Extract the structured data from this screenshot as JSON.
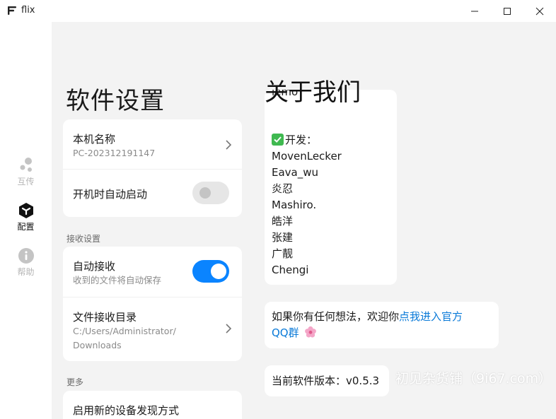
{
  "window": {
    "title": "flix",
    "min_icon": "minimize-icon",
    "max_icon": "maximize-icon",
    "close_icon": "close-icon"
  },
  "nav": {
    "items": [
      {
        "label": "互传",
        "icon": "share-icon",
        "active": false
      },
      {
        "label": "配置",
        "icon": "config-icon",
        "active": true
      },
      {
        "label": "帮助",
        "icon": "info-icon",
        "active": false
      }
    ]
  },
  "settings": {
    "title": "软件设置",
    "device_name_label": "本机名称",
    "device_name_value": "PC-202312191147",
    "autostart_label": "开机时自动启动",
    "autostart_on": false,
    "receive_section": "接收设置",
    "auto_receive_label": "自动接收",
    "auto_receive_desc": "收到的文件将自动保存",
    "auto_receive_on": true,
    "receive_dir_label": "文件接收目录",
    "receive_dir_line1": "C:/Users/Administrator/",
    "receive_dir_line2": "Downloads",
    "more_section": "更多",
    "new_discovery_label": "启用新的设备发现方式"
  },
  "about": {
    "title": "关于我们",
    "credits_partial": "lemo",
    "dev_heading": "开发：",
    "developers": [
      "MovenLecker",
      "Eava_wu",
      "炎忍",
      "Mashiro.",
      "皓洋",
      "张建",
      "广靓",
      "Chengi"
    ],
    "feedback_text": "如果你有任何想法，欢迎你",
    "feedback_link_1": "点我进入官方",
    "feedback_link_2": "QQ群",
    "version_text": "当前软件版本：v0.5.3"
  },
  "watermark": "初见杂货铺（9i67.com）",
  "colors": {
    "accent": "#0a84ff",
    "link": "#0a7ad8",
    "panel_bg": "#f3f3f3",
    "check": "#3fb950"
  }
}
